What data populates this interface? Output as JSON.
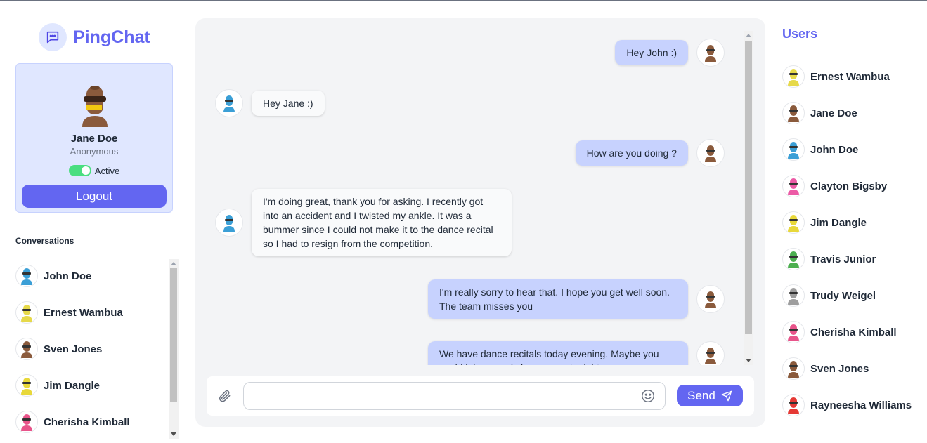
{
  "app": {
    "name": "PingChat"
  },
  "profile": {
    "name": "Jane Doe",
    "subtitle": "Anonymous",
    "status_label": "Active",
    "status_active": true,
    "logout_label": "Logout"
  },
  "conversations": {
    "title": "Conversations",
    "items": [
      {
        "name": "John Doe",
        "avatar_color": "#3b9fd6"
      },
      {
        "name": "Ernest Wambua",
        "avatar_color": "#e6d94a"
      },
      {
        "name": "Sven Jones",
        "avatar_color": "#8a5a3c"
      },
      {
        "name": "Jim Dangle",
        "avatar_color": "#e8d83a"
      },
      {
        "name": "Cherisha Kimball",
        "avatar_color": "#e8548a"
      }
    ]
  },
  "messages": [
    {
      "side": "out",
      "text": "Hey John :)",
      "avatar_color": "#8a5a3c"
    },
    {
      "side": "in",
      "text": "Hey Jane :)",
      "avatar_color": "#3b9fd6"
    },
    {
      "side": "out",
      "text": "How are you doing ?",
      "avatar_color": "#8a5a3c"
    },
    {
      "side": "in",
      "text": "I'm doing great, thank you for asking. I recently got into an accident and I twisted my ankle. It was a bummer since I could not make it to the dance recital so I had to resign from the competition.",
      "avatar_color": "#3b9fd6"
    },
    {
      "side": "out",
      "text": "I'm really sorry to hear that. I hope you get well soon. The team misses you",
      "avatar_color": "#8a5a3c"
    },
    {
      "side": "out",
      "text": "We have dance recitals today evening. Maybe you could join us and cheer us on tonight.",
      "avatar_color": "#8a5a3c"
    }
  ],
  "composer": {
    "placeholder": "",
    "value": "",
    "send_label": "Send"
  },
  "users": {
    "title": "Users",
    "items": [
      {
        "name": "Ernest Wambua",
        "avatar_color": "#e6d94a"
      },
      {
        "name": "Jane Doe",
        "avatar_color": "#8a5a3c"
      },
      {
        "name": "John Doe",
        "avatar_color": "#3b9fd6"
      },
      {
        "name": "Clayton Bigsby",
        "avatar_color": "#ec5aa6"
      },
      {
        "name": "Jim Dangle",
        "avatar_color": "#e8d83a"
      },
      {
        "name": "Travis Junior",
        "avatar_color": "#4caf50"
      },
      {
        "name": "Trudy Weigel",
        "avatar_color": "#9e9e9e"
      },
      {
        "name": "Cherisha Kimball",
        "avatar_color": "#e8548a"
      },
      {
        "name": "Sven Jones",
        "avatar_color": "#8a5a3c"
      },
      {
        "name": "Rayneesha Williams",
        "avatar_color": "#e53935"
      }
    ]
  },
  "colors": {
    "accent": "#6366f1",
    "accent_light": "#e0e7ff",
    "bubble_out": "#c7d2fe",
    "active": "#4ade80"
  }
}
